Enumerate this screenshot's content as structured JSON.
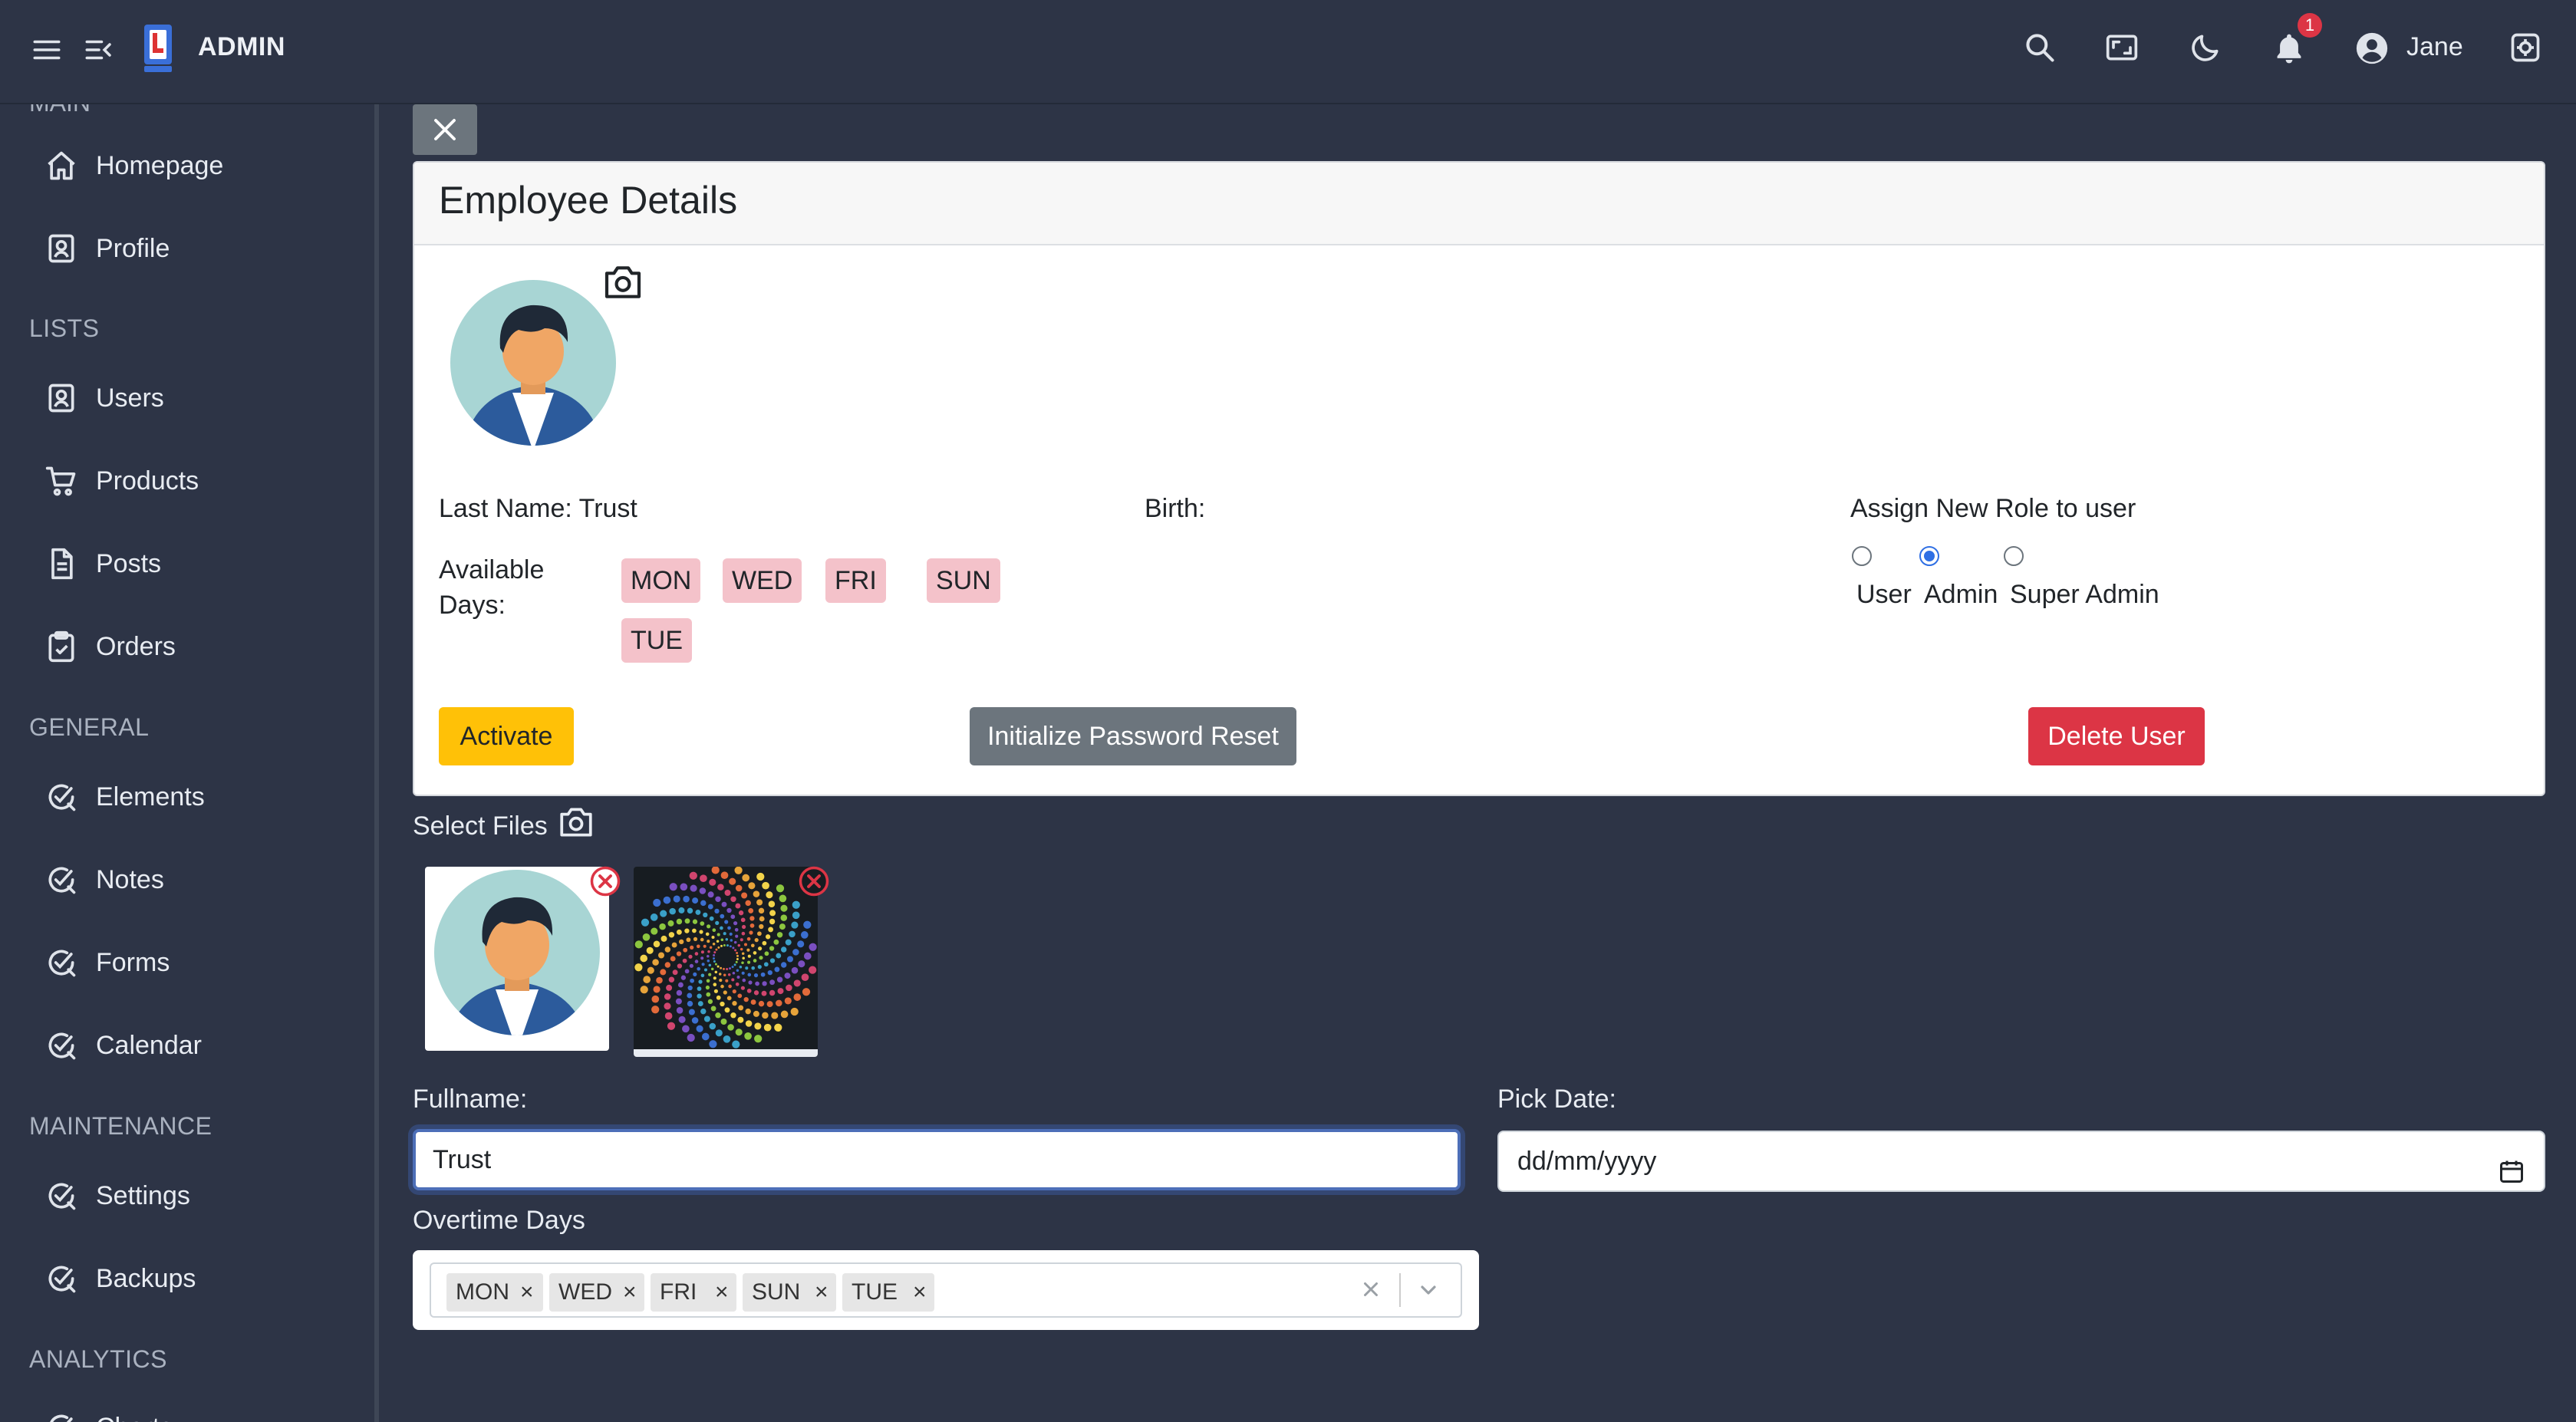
{
  "header": {
    "brand": "ADMIN",
    "notification_count": "1",
    "user_name": "Jane",
    "icons": [
      "menu-icon",
      "collapse-menu-icon",
      "logo-icon",
      "search-icon",
      "fullscreen-icon",
      "dark-mode-icon",
      "bell-icon",
      "user-circle-icon",
      "settings-icon"
    ]
  },
  "sidebar": {
    "cut_section": "MAIN",
    "sections": {
      "lists": "LISTS",
      "general": "GENERAL",
      "maintenance": "MAINTENANCE",
      "analytics": "ANALYTICS"
    },
    "items": {
      "homepage": "Homepage",
      "profile": "Profile",
      "users": "Users",
      "products": "Products",
      "posts": "Posts",
      "orders": "Orders",
      "elements": "Elements",
      "notes": "Notes",
      "forms": "Forms",
      "calendar": "Calendar",
      "settings": "Settings",
      "backups": "Backups",
      "charts": "Charts"
    }
  },
  "card": {
    "title": "Employee Details",
    "last_name": "Last Name: Trust",
    "birth": "Birth:",
    "available_days_line1": "Available",
    "available_days_line2": "Days:",
    "days": [
      "MON",
      "WED",
      "FRI",
      "SUN",
      "TUE"
    ],
    "role_title": "Assign New Role to user",
    "roles": [
      "User",
      "Admin",
      "Super Admin"
    ],
    "selected_role": "Admin",
    "activate": "Activate",
    "reset": "Initialize Password Reset",
    "delete": "Delete User"
  },
  "files": {
    "label": "Select Files"
  },
  "form": {
    "fullname_label": "Fullname:",
    "fullname_value": "Trust",
    "date_label": "Pick Date:",
    "date_value": "dd/mm/yyyy",
    "overtime_label": "Overtime Days",
    "overtime_days": [
      "MON",
      "WED",
      "FRI",
      "SUN",
      "TUE"
    ]
  },
  "colors": {
    "background": "#2d3446",
    "day_tag": "#f4c2ca",
    "activate": "#ffc107",
    "reset": "#6c757d",
    "delete": "#dc3545",
    "radio_selected": "#2f6fe4"
  }
}
